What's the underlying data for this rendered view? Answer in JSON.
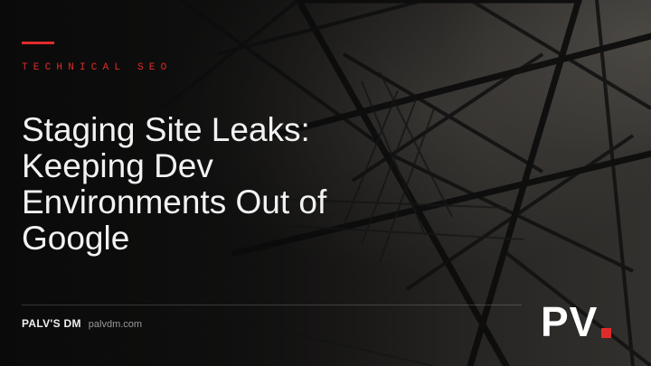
{
  "slide": {
    "eyebrow": "TECHNICAL SEO",
    "title_lines": [
      "Staging Site Leaks:",
      "Keeping Dev",
      "Environments Out of",
      "Google"
    ],
    "footer": {
      "brand": "PALV'S DM",
      "website": "palvdm.com"
    },
    "logo": {
      "letters": "PV"
    }
  },
  "colors": {
    "accent": "#e02b2b",
    "title": "#f2f2f2",
    "background": "#141414"
  },
  "background_image": "transmission-tower-lattice-photo"
}
